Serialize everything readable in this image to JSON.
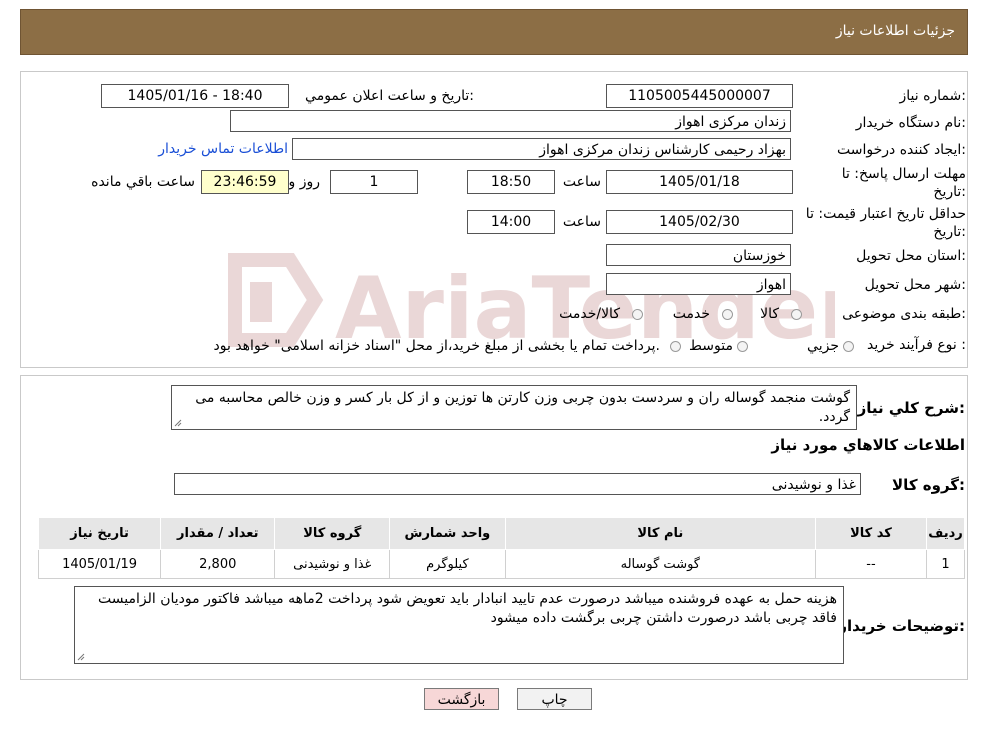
{
  "header": {
    "title": "جزئیات اطلاعات نیاز"
  },
  "watermark": {
    "text": "AriaTender.neT",
    "color": "#d9b8b8"
  },
  "form": {
    "need_number_label": "شماره نیاز:",
    "need_number": "1105005445000007",
    "announce_label": "تاریخ و ساعت اعلان عمومي:",
    "announce_value": "1405/01/16 - 18:40",
    "buyer_org_label": "نام دستگاه خریدار:",
    "buyer_org": "زندان مرکزی اهواز",
    "creator_label": "ایجاد کننده درخواست:",
    "creator": "بهزاد رحیمی کارشناس زندان مرکزی اهواز",
    "contact_link": "اطلاعات تماس خریدار",
    "deadline_label_1": "مهلت ارسال پاسخ: تا",
    "deadline_label_2": "تاریخ:",
    "deadline_date": "1405/01/18",
    "time_label": "ساعت",
    "deadline_time": "18:50",
    "days_value": "1",
    "days_label": "روز و",
    "remaining_time": "23:46:59",
    "remaining_label": "ساعت باقي مانده",
    "validity_label_1": "حداقل تاریخ اعتبار قیمت: تا",
    "validity_label_2": "تاریخ:",
    "validity_date": "1405/02/30",
    "validity_time": "14:00",
    "province_label": "استان محل تحویل:",
    "province": "خوزستان",
    "city_label": "شهر محل تحویل:",
    "city": "اهواز",
    "category_label": "طبقه بندی موضوعی:",
    "category_options": [
      "کالا",
      "خدمت",
      "کالا/خدمت"
    ],
    "process_label": "نوع فرآیند خرید :",
    "process_options": [
      "جزیي",
      "متوسط"
    ],
    "process_note": "پرداخت تمام یا بخشی از مبلغ خرید،از محل \"اسناد خزانه اسلامی\" خواهد بود."
  },
  "summary": {
    "label": "شرح کلي نیاز:",
    "text": "گوشت منجمد گوساله ران و سردست بدون چربی وزن کارتن ها توزین و از کل بار کسر و وزن خالص محاسبه می گردد.",
    "goods_info_title": "اطلاعات کالاهاي مورد نیاز",
    "group_label": "گروه کالا:",
    "group_value": "غذا و نوشیدنی"
  },
  "table": {
    "headers": [
      "ردیف",
      "کد کالا",
      "نام کالا",
      "واحد شمارش",
      "گروه کالا",
      "تعداد / مقدار",
      "تاریخ نیاز"
    ],
    "rows": [
      [
        "1",
        "--",
        "گوشت گوساله",
        "کیلوگرم",
        "غذا و نوشیدنی",
        "2,800",
        "1405/01/19"
      ]
    ]
  },
  "buyer_notes": {
    "label": "توضیحات خریدار:",
    "text": "هزینه حمل به عهده فروشنده میباشد درصورت عدم تایید انبادار باید تعویض شود پرداخت 2ماهه میباشد فاکتور مودیان الزامیست فاقد چربی باشد درصورت داشتن چربی برگشت داده میشود"
  },
  "buttons": {
    "print": "چاپ",
    "back": "بازگشت"
  }
}
